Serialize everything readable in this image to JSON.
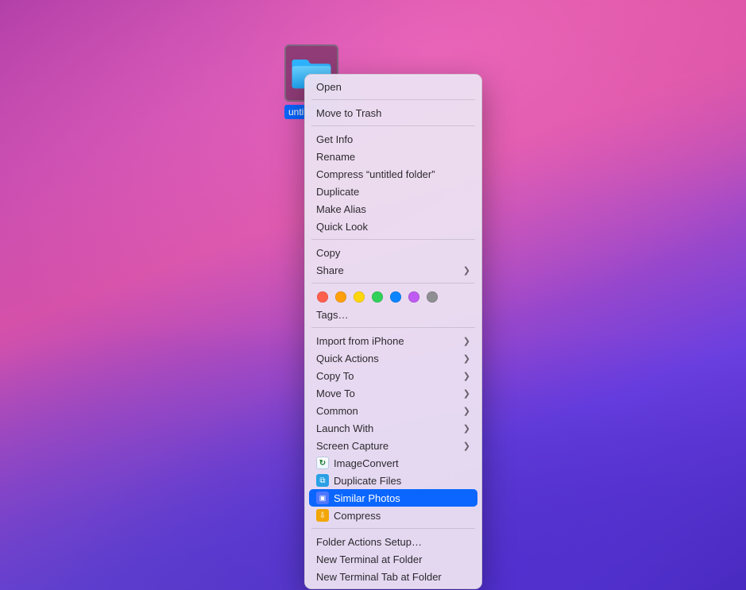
{
  "desktop": {
    "folder": {
      "label": "untitled folder"
    }
  },
  "menu": {
    "open": "Open",
    "move_to_trash": "Move to Trash",
    "get_info": "Get Info",
    "rename": "Rename",
    "compress_named": "Compress “untitled folder”",
    "duplicate": "Duplicate",
    "make_alias": "Make Alias",
    "quick_look": "Quick Look",
    "copy": "Copy",
    "share": "Share",
    "tag_colors": [
      "#ff5f4c",
      "#ff9f0a",
      "#ffd60a",
      "#30d158",
      "#0a84ff",
      "#bf5af2",
      "#8e8e93"
    ],
    "tags": "Tags…",
    "import_iphone": "Import from iPhone",
    "quick_actions": "Quick Actions",
    "copy_to": "Copy To",
    "move_to": "Move To",
    "common": "Common",
    "launch_with": "Launch With",
    "screen_capture": "Screen Capture",
    "image_convert": "ImageConvert",
    "duplicate_files": "Duplicate Files",
    "similar_photos": "Similar Photos",
    "compress_action": "Compress",
    "folder_actions_setup": "Folder Actions Setup…",
    "new_terminal_at": "New Terminal at Folder",
    "new_terminal_tab_at": "New Terminal Tab at Folder"
  }
}
